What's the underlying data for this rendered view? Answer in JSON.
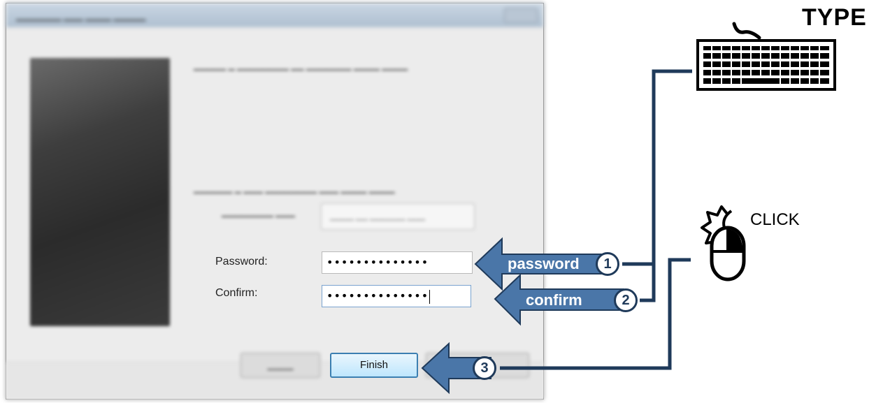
{
  "dialog": {
    "title": "",
    "fields": {
      "password_label": "Password:",
      "password_value": "••••••••••••••",
      "confirm_label": "Confirm:",
      "confirm_value": "••••••••••••••"
    },
    "buttons": {
      "finish_label": "Finish"
    }
  },
  "annotations": {
    "type_label": "TYPE",
    "click_label": "CLICK",
    "steps": [
      {
        "number": "1",
        "label": "password"
      },
      {
        "number": "2",
        "label": "confirm"
      },
      {
        "number": "3",
        "label": ""
      }
    ],
    "colors": {
      "arrow_fill": "#4a76a8",
      "connector": "#1f3a5a"
    },
    "icons": [
      "keyboard-icon",
      "mouse-icon",
      "click-burst-icon"
    ]
  }
}
